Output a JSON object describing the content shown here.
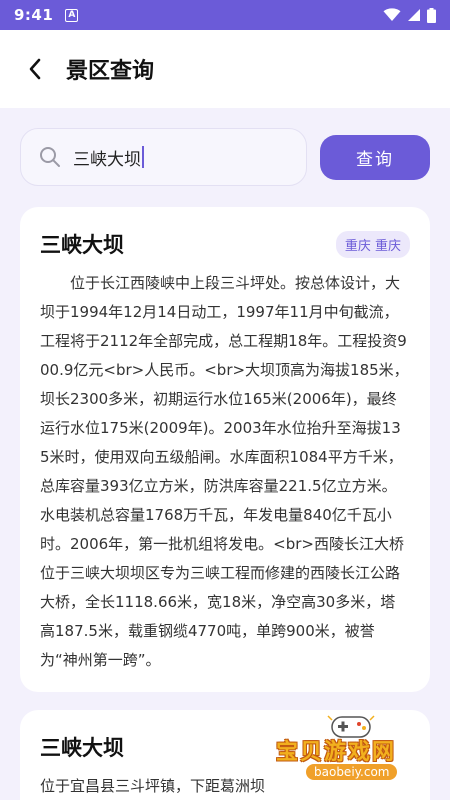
{
  "status_bar": {
    "time": "9:41",
    "notification_letter": "A",
    "icons": [
      "wifi-icon",
      "signal-icon",
      "battery-icon"
    ]
  },
  "header": {
    "title": "景区查询",
    "back_icon": "chevron-left-icon"
  },
  "search": {
    "value": "三峡大坝",
    "button_label": "查询"
  },
  "results": [
    {
      "name": "三峡大坝",
      "region": "重庆 重庆",
      "description": "位于长江西陵峡中上段三斗坪处。按总体设计，大坝于1994年12月14日动工，1997年11月中旬截流，工程将于2112年全部完成，总工程期18年。工程投资900.9亿元<br>人民币。<br>大坝顶高为海拔185米，坝长2300多米，初期运行水位165米(2006年)，最终运行水位175米(2009年)。2003年水位抬升至海拔135米时，使用双向五级船闸。水库面积1084平方千米，总库容量393亿立方米，防洪库容量221.5亿立方米。水电装机总容量1768万千瓦，年发电量840亿千瓦小时。2006年，第一批机组将发电。<br>西陵长江大桥位于三峡大坝坝区专为三峡工程而修建的西陵长江公路大桥，全长1118.66米，宽18米，净空高30多米，塔高187.5米，载重钢缆4770吨，单跨900米，被誉为“神州第一跨”。"
    },
    {
      "name": "三峡大坝",
      "region": "",
      "description": "位于宜昌县三斗坪镇，下距葛洲坝"
    }
  ],
  "watermark": {
    "text": "宝贝游戏网",
    "url": "baobeiy.com"
  },
  "colors": {
    "accent": "#6b5bd8",
    "background": "#f3f1fc",
    "badge_bg": "#ece8fb"
  }
}
